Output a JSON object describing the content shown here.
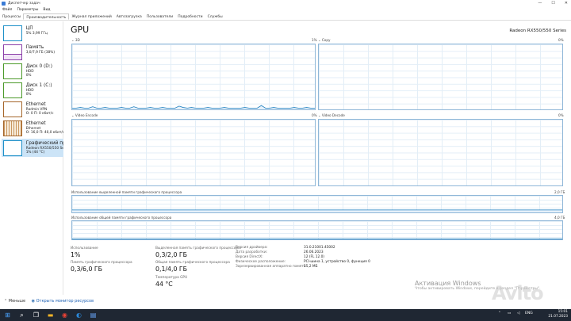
{
  "window": {
    "title": "Диспетчер задач",
    "min": "—",
    "max": "☐",
    "close": "✕"
  },
  "menu": [
    "Файл",
    "Параметры",
    "Вид"
  ],
  "tabs": [
    "Процессы",
    "Производительность",
    "Журнал приложений",
    "Автозагрузка",
    "Пользователи",
    "Подробности",
    "Службы"
  ],
  "active_tab": 1,
  "sidebar": [
    {
      "title": "ЦП",
      "l1": "5% 3,99 ГГц",
      "l2": "",
      "color": "#1e90c8"
    },
    {
      "title": "Память",
      "l1": "3,0/7,9 ГБ (38%)",
      "l2": "",
      "color": "#8b3fa9"
    },
    {
      "title": "Диск 0 (D:)",
      "l1": "HDD",
      "l2": "0%",
      "color": "#4c9a2a"
    },
    {
      "title": "Диск 1 (C:)",
      "l1": "HDD",
      "l2": "0%",
      "color": "#4c9a2a"
    },
    {
      "title": "Ethernet",
      "l1": "Radmin VPN",
      "l2": "О: 0 П: 0 кбит/с",
      "color": "#a5662b"
    },
    {
      "title": "Ethernet",
      "l1": "Ethernet",
      "l2": "О: 16,0 П: 40,0 кбит/с",
      "color": "#a5662b"
    },
    {
      "title": "Графический процессор 0",
      "l1": "Radeon RX550/550 Series",
      "l2": "1% (44 °C)",
      "color": "#1e90c8"
    }
  ],
  "gpu": {
    "title": "GPU",
    "model": "Radeon RX550/550 Series"
  },
  "engines": [
    {
      "name": "3D",
      "pct": "1%"
    },
    {
      "name": "Copy",
      "pct": "0%"
    },
    {
      "name": "Video Encode",
      "pct": "0%"
    },
    {
      "name": "Video Decode",
      "pct": "0%"
    }
  ],
  "dedicated_mem": {
    "label": "Использование выделенной памяти графического процессора",
    "max": "2,0 ГБ"
  },
  "shared_mem": {
    "label": "Использование общей памяти графического процессора",
    "max": "4,0 ГБ"
  },
  "stats": {
    "util_label": "Использование",
    "util": "1%",
    "dedicated_label": "Выделенная память графического процессора",
    "dedicated": "0,3/2,0 ГБ",
    "gpu_mem_label": "Память графического процессора",
    "gpu_mem": "0,3/6,0 ГБ",
    "shared_label": "Общая память графического процессора",
    "shared": "0,1/4,0 ГБ",
    "temp_label": "Температура GPU",
    "temp": "44 °C"
  },
  "info": [
    {
      "k": "Версия драйвера:",
      "v": "31.0.21001.45002"
    },
    {
      "k": "Дата разработки:",
      "v": "26.06.2023"
    },
    {
      "k": "Версия DirectX:",
      "v": "12 (FL 12.0)"
    },
    {
      "k": "Физическое расположение:",
      "v": "PCI-шина 1, устройство 0, функция 0"
    },
    {
      "k": "Зарезервированная аппаратно память:",
      "v": "55,2 МБ"
    }
  ],
  "footer": {
    "less": "Меньше",
    "monitor": "Открыть монитор ресурсов"
  },
  "watermark": {
    "line1": "Активация Windows",
    "line2": "Чтобы активировать Windows, перейдите в раздел \"Параметры\"."
  },
  "avito": "Avito",
  "tray": {
    "lang": "ENG",
    "time": "15:01",
    "date": "21.07.2023"
  },
  "series": {
    "d3": [
      0.02,
      0.02,
      0.03,
      0.02,
      0.02,
      0.04,
      0.02,
      0.02,
      0.03,
      0.02,
      0.02,
      0.02,
      0.03,
      0.02,
      0.02,
      0.04,
      0.02,
      0.02,
      0.02,
      0.03,
      0.02,
      0.02,
      0.03,
      0.02,
      0.02,
      0.02,
      0.05,
      0.03,
      0.02,
      0.03,
      0.02,
      0.02,
      0.02,
      0.03,
      0.02,
      0.02,
      0.02,
      0.03,
      0.02,
      0.02,
      0.02,
      0.02,
      0.03,
      0.02,
      0.02,
      0.02,
      0.06,
      0.02,
      0.02,
      0.03,
      0.02,
      0.02,
      0.02,
      0.02,
      0.03,
      0.02,
      0.02,
      0.03,
      0.02,
      0.02
    ],
    "shared": [
      0.02,
      0.02,
      0.02,
      0.02,
      0.02,
      0.02,
      0.02,
      0.02,
      0.02,
      0.02,
      0.02,
      0.02,
      0.02,
      0.02,
      0.02,
      0.02,
      0.02,
      0.02,
      0.02,
      0.02,
      0.02,
      0.02,
      0.02,
      0.02,
      0.02,
      0.02,
      0.02,
      0.02,
      0.02,
      0.02
    ],
    "dedicated": 0.15,
    "cpu_thumb": [
      0.05,
      0.04,
      0.06,
      0.05,
      0.04,
      0.05,
      0.07,
      0.05,
      0.04,
      0.05,
      0.06,
      0.05
    ],
    "mem_thumb": 0.38
  }
}
